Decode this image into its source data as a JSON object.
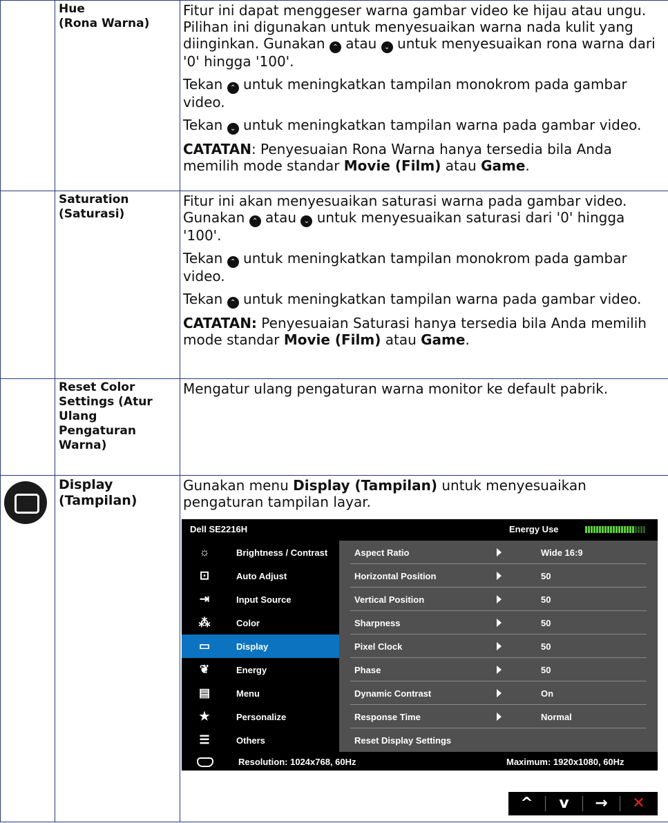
{
  "rows": {
    "hue": {
      "label1": "Hue",
      "label2": "(Rona Warna)",
      "p1a": "Fitur ini dapat menggeser warna gambar video ke hijau atau ungu. Pilihan ini digunakan untuk menyesuaikan warna nada kulit yang diinginkan. Gunakan ",
      "p1b": " atau ",
      "p1c": " untuk menyesuaikan rona warna dari '0' hingga '100'.",
      "p2a": "Tekan ",
      "p2b": " untuk meningkatkan tampilan monokrom pada gambar video.",
      "p3a": "Tekan ",
      "p3b": " untuk meningkatkan tampilan warna pada gambar video.",
      "note_label": "CATATAN",
      "note_a": ": Penyesuaian Rona Warna hanya tersedia bila Anda memilih mode standar ",
      "note_b": "Movie (Film)",
      "note_c": " atau ",
      "note_d": "Game",
      "note_e": "."
    },
    "saturation": {
      "label1": "Saturation",
      "label2": "(Saturasi)",
      "p1a": "Fitur ini akan menyesuaikan saturasi warna pada gambar video. Gunakan ",
      "p1b": " atau ",
      "p1c": " untuk menyesuaikan saturasi dari '0' hingga '100'.",
      "p2a": "Tekan ",
      "p2b": " untuk meningkatkan tampilan monokrom pada gambar video.",
      "p3a": "Tekan ",
      "p3b": " untuk meningkatkan tampilan warna pada gambar video.",
      "note_label": "CATATAN:",
      "note_a": " Penyesuaian Saturasi hanya tersedia bila Anda memilih mode standar ",
      "note_b": "Movie (Film)",
      "note_c": " atau ",
      "note_d": "Game",
      "note_e": "."
    },
    "reset": {
      "label": "Reset Color Settings (Atur Ulang Pengaturan Warna)",
      "desc": "Mengatur ulang pengaturan warna monitor ke default pabrik."
    },
    "display": {
      "label1": "Display",
      "label2": "(Tampilan)",
      "desc_a": "Gunakan menu ",
      "desc_b": "Display (Tampilan)",
      "desc_c": " untuk menyesuaikan pengaturan tampilan layar."
    }
  },
  "icons": {
    "up": "up-circle-icon",
    "down": "down-circle-icon",
    "display": "display-icon"
  },
  "osd": {
    "model": "Dell SE2216H",
    "energy_label": "Energy Use",
    "energy_level": 0.82,
    "menu": [
      {
        "label": "Brightness / Contrast",
        "icon": "brightness-icon",
        "selected": false
      },
      {
        "label": "Auto Adjust",
        "icon": "auto-adjust-icon",
        "selected": false
      },
      {
        "label": "Input Source",
        "icon": "input-source-icon",
        "selected": false
      },
      {
        "label": "Color",
        "icon": "color-icon",
        "selected": false
      },
      {
        "label": "Display",
        "icon": "display-icon",
        "selected": true
      },
      {
        "label": "Energy",
        "icon": "energy-icon",
        "selected": false
      },
      {
        "label": "Menu",
        "icon": "menu-icon",
        "selected": false
      },
      {
        "label": "Personalize",
        "icon": "star-icon",
        "selected": false
      },
      {
        "label": "Others",
        "icon": "others-icon",
        "selected": false
      }
    ],
    "settings": [
      {
        "label": "Aspect Ratio",
        "value": "Wide 16:9"
      },
      {
        "label": "Horizontal Position",
        "value": "50"
      },
      {
        "label": "Vertical Position",
        "value": "50"
      },
      {
        "label": "Sharpness",
        "value": "50"
      },
      {
        "label": "Pixel Clock",
        "value": "50"
      },
      {
        "label": "Phase",
        "value": "50"
      },
      {
        "label": "Dynamic Contrast",
        "value": "On"
      },
      {
        "label": "Response Time",
        "value": "Normal"
      },
      {
        "label": "Reset Display Settings",
        "value": ""
      }
    ],
    "resolution": "Resolution: 1024x768, 60Hz",
    "maximum": "Maximum: 1920x1080, 60Hz",
    "colors": {
      "selected": "#0b73bf",
      "panel": "#505050",
      "meter": "#5cd23a"
    }
  },
  "nav_buttons": [
    {
      "name": "up-button",
      "glyph": "^",
      "icon": "chevron-up-icon"
    },
    {
      "name": "down-button",
      "glyph": "v",
      "icon": "chevron-down-icon"
    },
    {
      "name": "next-button",
      "glyph": "→",
      "icon": "arrow-right-icon"
    },
    {
      "name": "exit-button",
      "glyph": "✕",
      "icon": "close-icon"
    }
  ]
}
